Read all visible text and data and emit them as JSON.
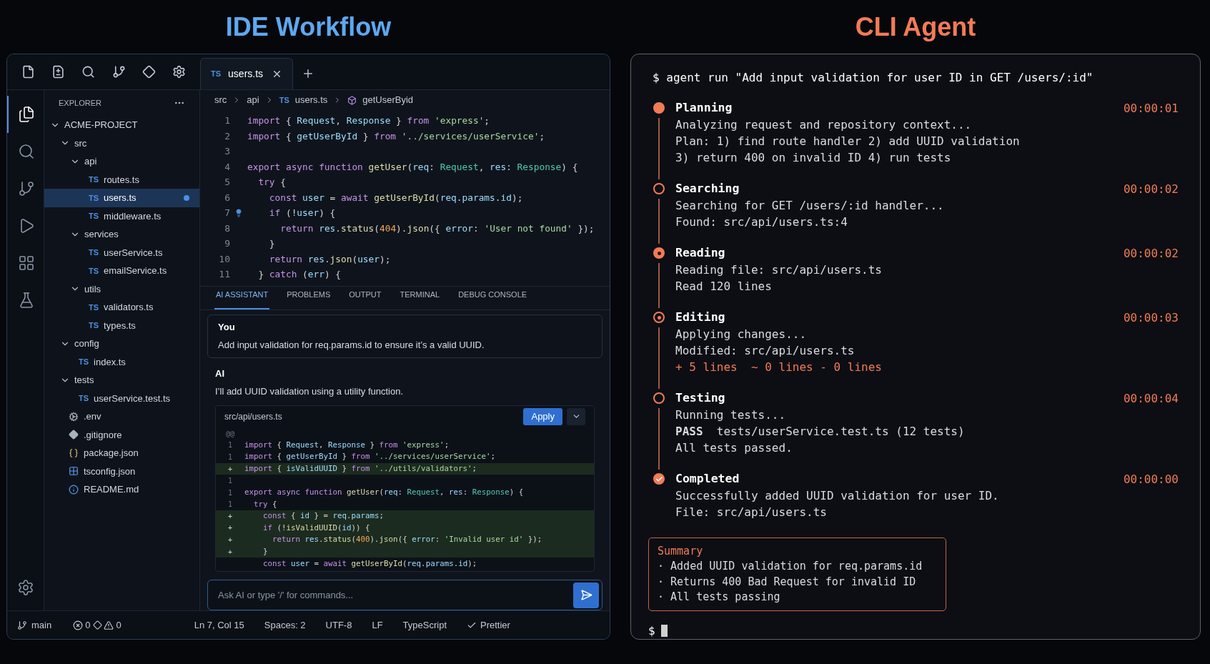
{
  "headings": {
    "ide": "IDE Workflow",
    "cli": "CLI Agent"
  },
  "ide": {
    "top_icons": [
      {
        "kind": "file"
      },
      {
        "kind": "file-diff"
      },
      {
        "kind": "search"
      },
      {
        "kind": "branch"
      },
      {
        "kind": "diamond"
      },
      {
        "kind": "gear"
      }
    ],
    "tabs": [
      {
        "badge": "TS",
        "label": "users.ts",
        "selected": true
      }
    ],
    "activity_bar": [
      {
        "kind": "files",
        "selected": true
      },
      {
        "kind": "search",
        "selected": false
      },
      {
        "kind": "branch",
        "selected": false
      },
      {
        "kind": "run",
        "selected": false
      },
      {
        "kind": "extensions",
        "selected": false
      },
      {
        "kind": "flask",
        "selected": false
      }
    ],
    "explorer": {
      "title": "EXPLORER",
      "tree": [
        {
          "label": "ACME-PROJECT",
          "kind": "folder",
          "expanded": true,
          "children": [
            {
              "label": "src",
              "kind": "folder",
              "expanded": true,
              "children": [
                {
                  "label": "api",
                  "kind": "folder",
                  "expanded": true,
                  "children": [
                    {
                      "label": "routes.ts",
                      "kind": "ts",
                      "badge": "TS",
                      "selected": false,
                      "modified": false
                    },
                    {
                      "label": "users.ts",
                      "kind": "ts",
                      "badge": "TS",
                      "selected": true,
                      "modified": true
                    },
                    {
                      "label": "middleware.ts",
                      "kind": "ts",
                      "badge": "TS",
                      "selected": false,
                      "modified": false
                    }
                  ]
                },
                {
                  "label": "services",
                  "kind": "folder",
                  "expanded": true,
                  "children": [
                    {
                      "label": "userService.ts",
                      "kind": "ts",
                      "badge": "TS",
                      "selected": false,
                      "modified": false
                    },
                    {
                      "label": "emailService.ts",
                      "kind": "ts",
                      "badge": "TS",
                      "selected": false,
                      "modified": false
                    }
                  ]
                },
                {
                  "label": "utils",
                  "kind": "folder",
                  "expanded": true,
                  "children": [
                    {
                      "label": "validators.ts",
                      "kind": "ts",
                      "badge": "TS",
                      "selected": false,
                      "modified": false
                    },
                    {
                      "label": "types.ts",
                      "kind": "ts",
                      "badge": "TS",
                      "selected": false,
                      "modified": false
                    }
                  ]
                }
              ]
            },
            {
              "label": "config",
              "kind": "folder",
              "expanded": true,
              "children": [
                {
                  "label": "index.ts",
                  "kind": "ts",
                  "badge": "TS",
                  "selected": false,
                  "modified": false
                }
              ]
            },
            {
              "label": "tests",
              "kind": "folder",
              "expanded": true,
              "children": [
                {
                  "label": "userService.test.ts",
                  "kind": "ts",
                  "badge": "TS",
                  "selected": false,
                  "modified": false
                }
              ]
            },
            {
              "label": ".env",
              "kind": "env",
              "selected": false,
              "modified": false
            },
            {
              "label": ".gitignore",
              "kind": "git",
              "selected": false,
              "modified": false
            },
            {
              "label": "package.json",
              "kind": "json",
              "selected": false,
              "modified": false
            },
            {
              "label": "tsconfig.json",
              "kind": "config",
              "selected": false,
              "modified": false
            },
            {
              "label": "README.md",
              "kind": "readme",
              "selected": false,
              "modified": false
            }
          ]
        }
      ]
    },
    "breadcrumb": [
      {
        "label": "src"
      },
      {
        "label": "api"
      },
      {
        "label": "users.ts",
        "badge": "TS"
      },
      {
        "label": "getUserByid",
        "kind": "symbol"
      }
    ],
    "code": [
      {
        "n": "1",
        "lightbulb": false,
        "tokens": [
          {
            "text": "import ",
            "kind": "keyword"
          },
          {
            "text": "{ ",
            "kind": "plain"
          },
          {
            "text": "Request",
            "kind": "name"
          },
          {
            "text": ", ",
            "kind": "plain"
          },
          {
            "text": "Response",
            "kind": "name"
          },
          {
            "text": " } ",
            "kind": "plain"
          },
          {
            "text": "from ",
            "kind": "keyword"
          },
          {
            "text": "'express'",
            "kind": "string"
          },
          {
            "text": ";",
            "kind": "plain"
          }
        ]
      },
      {
        "n": "2",
        "lightbulb": false,
        "tokens": [
          {
            "text": "import ",
            "kind": "keyword"
          },
          {
            "text": "{ ",
            "kind": "plain"
          },
          {
            "text": "getUserById",
            "kind": "name"
          },
          {
            "text": " } ",
            "kind": "plain"
          },
          {
            "text": "from ",
            "kind": "keyword"
          },
          {
            "text": "'../services/userService'",
            "kind": "string"
          },
          {
            "text": ";",
            "kind": "plain"
          }
        ]
      },
      {
        "n": "3",
        "lightbulb": false
      },
      {
        "n": "4",
        "lightbulb": false,
        "tokens": [
          {
            "text": "export async function ",
            "kind": "keyword"
          },
          {
            "text": "getUser",
            "kind": "func"
          },
          {
            "text": "(",
            "kind": "plain"
          },
          {
            "text": "req",
            "kind": "name"
          },
          {
            "text": ": ",
            "kind": "plain"
          },
          {
            "text": "Request",
            "kind": "type"
          },
          {
            "text": ", ",
            "kind": "plain"
          },
          {
            "text": "res",
            "kind": "name"
          },
          {
            "text": ": ",
            "kind": "plain"
          },
          {
            "text": "Response",
            "kind": "type"
          },
          {
            "text": ") {",
            "kind": "plain"
          }
        ]
      },
      {
        "n": "5",
        "lightbulb": false,
        "tokens": [
          {
            "text": "  try",
            "kind": "keyword"
          },
          {
            "text": " {",
            "kind": "plain"
          }
        ]
      },
      {
        "n": "6",
        "lightbulb": false,
        "tokens": [
          {
            "text": "    const ",
            "kind": "keyword"
          },
          {
            "text": "user",
            "kind": "name"
          },
          {
            "text": " = ",
            "kind": "plain"
          },
          {
            "text": "await ",
            "kind": "keyword"
          },
          {
            "text": "getUserById",
            "kind": "func"
          },
          {
            "text": "(",
            "kind": "plain"
          },
          {
            "text": "req",
            "kind": "name"
          },
          {
            "text": ".",
            "kind": "plain"
          },
          {
            "text": "params",
            "kind": "name"
          },
          {
            "text": ".",
            "kind": "plain"
          },
          {
            "text": "id",
            "kind": "name"
          },
          {
            "text": ");",
            "kind": "plain"
          }
        ]
      },
      {
        "n": "7",
        "lightbulb": true,
        "tokens": [
          {
            "text": "    if",
            "kind": "keyword"
          },
          {
            "text": " (!",
            "kind": "plain"
          },
          {
            "text": "user",
            "kind": "name"
          },
          {
            "text": ") {",
            "kind": "plain"
          }
        ]
      },
      {
        "n": "8",
        "lightbulb": false,
        "tokens": [
          {
            "text": "      return ",
            "kind": "keyword"
          },
          {
            "text": "res",
            "kind": "name"
          },
          {
            "text": ".",
            "kind": "plain"
          },
          {
            "text": "status",
            "kind": "func"
          },
          {
            "text": "(",
            "kind": "plain"
          },
          {
            "text": "404",
            "kind": "number"
          },
          {
            "text": ").",
            "kind": "plain"
          },
          {
            "text": "json",
            "kind": "func"
          },
          {
            "text": "({ ",
            "kind": "plain"
          },
          {
            "text": "error",
            "kind": "name"
          },
          {
            "text": ": ",
            "kind": "plain"
          },
          {
            "text": "'User not found'",
            "kind": "string"
          },
          {
            "text": " });",
            "kind": "plain"
          }
        ]
      },
      {
        "n": "9",
        "lightbulb": false,
        "tokens": [
          {
            "text": "    }",
            "kind": "plain"
          }
        ]
      },
      {
        "n": "10",
        "lightbulb": false,
        "tokens": [
          {
            "text": "    return ",
            "kind": "keyword"
          },
          {
            "text": "res",
            "kind": "name"
          },
          {
            "text": ".",
            "kind": "plain"
          },
          {
            "text": "json",
            "kind": "func"
          },
          {
            "text": "(",
            "kind": "plain"
          },
          {
            "text": "user",
            "kind": "name"
          },
          {
            "text": ");",
            "kind": "plain"
          }
        ]
      },
      {
        "n": "11",
        "lightbulb": false,
        "tokens": [
          {
            "text": "  } ",
            "kind": "plain"
          },
          {
            "text": "catch",
            "kind": "keyword"
          },
          {
            "text": " (",
            "kind": "plain"
          },
          {
            "text": "err",
            "kind": "name"
          },
          {
            "text": ") {",
            "kind": "plain"
          }
        ]
      }
    ],
    "panel_tabs": [
      {
        "label": "AI ASSISTANT",
        "selected": true
      },
      {
        "label": "PROBLEMS",
        "selected": false
      },
      {
        "label": "OUTPUT",
        "selected": false
      },
      {
        "label": "TERMINAL",
        "selected": false
      },
      {
        "label": "DEBUG CONSOLE",
        "selected": false
      }
    ],
    "chat": {
      "user": {
        "author": "You",
        "text": "Add input validation for req.params.id to ensure it’s a valid UUID."
      },
      "ai": {
        "author": "AI",
        "text": "I’ll add UUID validation using a utility function."
      },
      "diff": {
        "file": "src/api/users.ts",
        "apply": "Apply",
        "lines": [
          {
            "mark": "@@",
            "added": false
          },
          {
            "mark": "1",
            "added": false,
            "tokens": [
              {
                "text": "import ",
                "kind": "keyword"
              },
              {
                "text": "{ ",
                "kind": "plain"
              },
              {
                "text": "Request",
                "kind": "name"
              },
              {
                "text": ", ",
                "kind": "plain"
              },
              {
                "text": "Response",
                "kind": "name"
              },
              {
                "text": " } ",
                "kind": "plain"
              },
              {
                "text": "from ",
                "kind": "keyword"
              },
              {
                "text": "'express'",
                "kind": "string"
              },
              {
                "text": ";",
                "kind": "plain"
              }
            ]
          },
          {
            "mark": "1",
            "added": false,
            "tokens": [
              {
                "text": "import ",
                "kind": "keyword"
              },
              {
                "text": "{ ",
                "kind": "plain"
              },
              {
                "text": "getUserById",
                "kind": "name"
              },
              {
                "text": " } ",
                "kind": "plain"
              },
              {
                "text": "from ",
                "kind": "keyword"
              },
              {
                "text": "'../services/userService'",
                "kind": "string"
              },
              {
                "text": ";",
                "kind": "plain"
              }
            ]
          },
          {
            "mark": "+",
            "added": true,
            "tokens": [
              {
                "text": "import ",
                "kind": "keyword"
              },
              {
                "text": "{ ",
                "kind": "plain"
              },
              {
                "text": "isValidUUID",
                "kind": "name"
              },
              {
                "text": " } ",
                "kind": "plain"
              },
              {
                "text": "from ",
                "kind": "keyword"
              },
              {
                "text": "'../utils/validators'",
                "kind": "string"
              },
              {
                "text": ";",
                "kind": "plain"
              }
            ]
          },
          {
            "mark": "1",
            "added": false
          },
          {
            "mark": "1",
            "added": false,
            "tokens": [
              {
                "text": "export async function ",
                "kind": "keyword"
              },
              {
                "text": "getUser",
                "kind": "func"
              },
              {
                "text": "(",
                "kind": "plain"
              },
              {
                "text": "req",
                "kind": "name"
              },
              {
                "text": ": ",
                "kind": "plain"
              },
              {
                "text": "Request",
                "kind": "type"
              },
              {
                "text": ", ",
                "kind": "plain"
              },
              {
                "text": "res",
                "kind": "name"
              },
              {
                "text": ": ",
                "kind": "plain"
              },
              {
                "text": "Response",
                "kind": "type"
              },
              {
                "text": ") {",
                "kind": "plain"
              }
            ]
          },
          {
            "mark": "1",
            "added": false,
            "tokens": [
              {
                "text": "  try",
                "kind": "keyword"
              },
              {
                "text": " {",
                "kind": "plain"
              }
            ]
          },
          {
            "mark": "+",
            "added": true,
            "tokens": [
              {
                "text": "    const ",
                "kind": "keyword"
              },
              {
                "text": "{ ",
                "kind": "plain"
              },
              {
                "text": "id",
                "kind": "name"
              },
              {
                "text": " } = ",
                "kind": "plain"
              },
              {
                "text": "req",
                "kind": "name"
              },
              {
                "text": ".",
                "kind": "plain"
              },
              {
                "text": "params",
                "kind": "name"
              },
              {
                "text": ";",
                "kind": "plain"
              }
            ]
          },
          {
            "mark": "+",
            "added": true,
            "tokens": [
              {
                "text": "    if",
                "kind": "keyword"
              },
              {
                "text": " (!",
                "kind": "plain"
              },
              {
                "text": "isValidUUID",
                "kind": "func"
              },
              {
                "text": "(",
                "kind": "plain"
              },
              {
                "text": "id",
                "kind": "name"
              },
              {
                "text": ")) {",
                "kind": "plain"
              }
            ]
          },
          {
            "mark": "+",
            "added": true,
            "tokens": [
              {
                "text": "      return ",
                "kind": "keyword"
              },
              {
                "text": "res",
                "kind": "name"
              },
              {
                "text": ".",
                "kind": "plain"
              },
              {
                "text": "status",
                "kind": "func"
              },
              {
                "text": "(",
                "kind": "plain"
              },
              {
                "text": "400",
                "kind": "number"
              },
              {
                "text": ").",
                "kind": "plain"
              },
              {
                "text": "json",
                "kind": "func"
              },
              {
                "text": "({ ",
                "kind": "plain"
              },
              {
                "text": "error",
                "kind": "name"
              },
              {
                "text": ": ",
                "kind": "plain"
              },
              {
                "text": "'Invalid user id'",
                "kind": "string"
              },
              {
                "text": " });",
                "kind": "plain"
              }
            ]
          },
          {
            "mark": "+",
            "added": true,
            "tokens": [
              {
                "text": "    }",
                "kind": "plain"
              }
            ]
          },
          {
            "added": false,
            "tokens": [
              {
                "text": "    const ",
                "kind": "keyword"
              },
              {
                "text": "user",
                "kind": "name"
              },
              {
                "text": " = ",
                "kind": "plain"
              },
              {
                "text": "await ",
                "kind": "keyword"
              },
              {
                "text": "getUserById",
                "kind": "func"
              },
              {
                "text": "(",
                "kind": "plain"
              },
              {
                "text": "req",
                "kind": "name"
              },
              {
                "text": ".",
                "kind": "plain"
              },
              {
                "text": "params",
                "kind": "name"
              },
              {
                "text": ".",
                "kind": "plain"
              },
              {
                "text": "id",
                "kind": "name"
              },
              {
                "text": ");",
                "kind": "plain"
              }
            ]
          }
        ]
      },
      "input": {
        "placeholder": "Ask AI or type '/' for commands..."
      }
    },
    "status_bar": {
      "branch": "main",
      "errors": "0",
      "warnings": "0",
      "items": [
        "Ln 7, Col 15",
        "Spaces: 2",
        "UTF-8",
        "LF",
        "TypeScript"
      ],
      "formatter": "Prettier"
    }
  },
  "cli": {
    "command": "$ agent run \"Add input validation for user ID in GET /users/:id\"",
    "steps": [
      {
        "title": "Planning",
        "kind": "filled",
        "time": "00:00:01",
        "lines": [
          {
            "kind": "plain",
            "text": "Analyzing request and repository context..."
          },
          {
            "kind": "plain",
            "text": "Plan: 1) find route handler 2) add UUID validation"
          },
          {
            "kind": "plain",
            "text": "3) return 400 on invalid ID 4) run tests"
          }
        ]
      },
      {
        "title": "Searching",
        "kind": "ring",
        "time": "00:00:02",
        "lines": [
          {
            "kind": "plain",
            "text": "Searching for GET /users/:id handler..."
          },
          {
            "kind": "plain",
            "text": "Found: src/api/users.ts:4"
          }
        ]
      },
      {
        "title": "Reading",
        "kind": "bullseye",
        "time": "00:00:02",
        "lines": [
          {
            "kind": "plain",
            "text": "Reading file: src/api/users.ts"
          },
          {
            "kind": "plain",
            "text": "Read 120 lines"
          }
        ]
      },
      {
        "title": "Editing",
        "kind": "target",
        "time": "00:00:03",
        "lines": [
          {
            "kind": "plain",
            "text": "Applying changes..."
          },
          {
            "kind": "plain",
            "text": "Modified: src/api/users.ts"
          },
          {
            "kind": "diffstat",
            "text": "+ 5 lines  ~ 0 lines - 0 lines"
          }
        ]
      },
      {
        "title": "Testing",
        "kind": "ring",
        "time": "00:00:04",
        "lines": [
          {
            "kind": "plain",
            "text": "Running tests..."
          },
          {
            "kind": "plain",
            "text": "**PASS**  tests/userService.test.ts (12 tests)"
          },
          {
            "kind": "plain",
            "text": "All tests passed."
          }
        ]
      },
      {
        "title": "Completed",
        "kind": "check",
        "time": "00:00:00",
        "lines": [
          {
            "kind": "plain",
            "text": "Successfully added UUID validation for user ID."
          },
          {
            "kind": "plain",
            "text": "File: src/api/users.ts"
          }
        ]
      }
    ],
    "summary": {
      "title": "Summary",
      "items": [
        "· Added UUID validation for req.params.id",
        "· Returns 400 Bad Request for invalid ID",
        "· All tests passing"
      ]
    },
    "prompt": "$"
  }
}
